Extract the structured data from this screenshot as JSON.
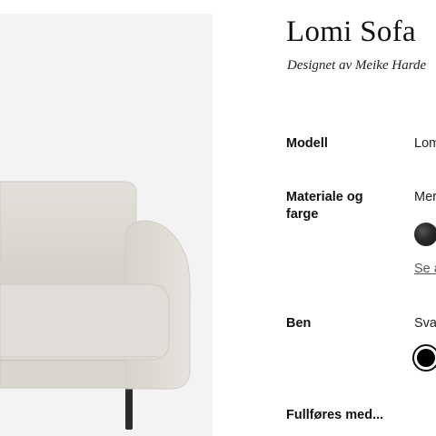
{
  "product": {
    "title": "Lomi Sofa",
    "designer": "Designet av Meike Harde",
    "image_alt": "Lomi Sofa i lys grått stoff med svarte metallben"
  },
  "specs": {
    "model": {
      "label": "Modell",
      "value": "Lom"
    },
    "material": {
      "label": "Materiale og farge",
      "value": "Mer",
      "link": "Se a",
      "swatch_color": "#2a2a2a"
    },
    "legs": {
      "label": "Ben",
      "value": "Svar",
      "swatch_color": "#000000"
    },
    "complete_with": {
      "label": "Fullføres med..."
    }
  },
  "colors": {
    "gallery_bg": "#f3f3f3",
    "fabric": "#ddd9d4",
    "leg": "#2b2b2b"
  }
}
